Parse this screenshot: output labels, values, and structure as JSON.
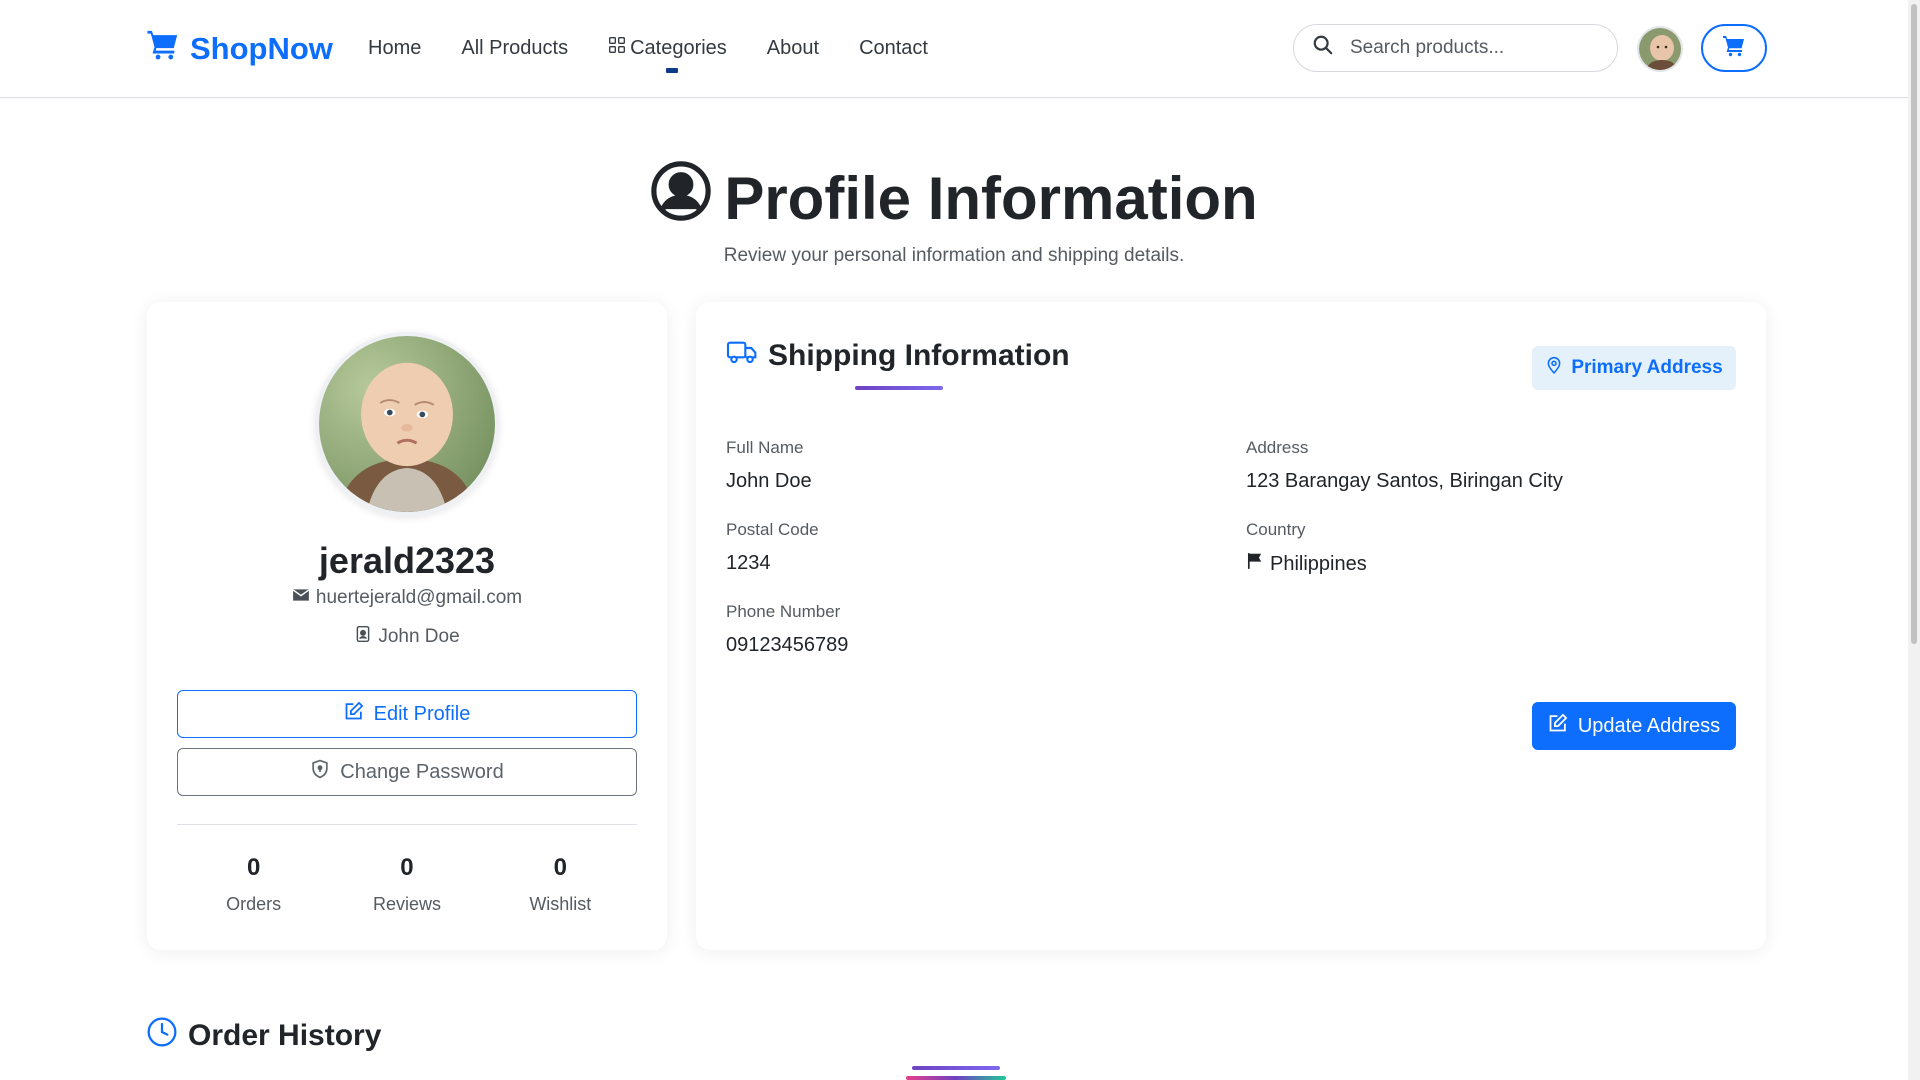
{
  "brand": {
    "name": "ShopNow",
    "color": "#0d6efd"
  },
  "nav": {
    "links": [
      {
        "label": "Home"
      },
      {
        "label": "All Products"
      },
      {
        "label": "Categories",
        "icon": "grid-icon"
      },
      {
        "label": "About"
      },
      {
        "label": "Contact"
      }
    ],
    "search_placeholder": "Search products..."
  },
  "hero": {
    "title": "Profile Information",
    "subtitle": "Review your personal information and shipping details."
  },
  "profile": {
    "username": "jerald2323",
    "email": "huertejerald@gmail.com",
    "full_name": "John Doe",
    "edit_label": "Edit Profile",
    "password_label": "Change Password",
    "stats": [
      {
        "value": "0",
        "label": "Orders"
      },
      {
        "value": "0",
        "label": "Reviews"
      },
      {
        "value": "0",
        "label": "Wishlist"
      }
    ]
  },
  "shipping": {
    "title": "Shipping Information",
    "badge": "Primary Address",
    "fields": {
      "full_name": {
        "label": "Full Name",
        "value": "John Doe"
      },
      "address": {
        "label": "Address",
        "value": "123 Barangay Santos, Biringan City"
      },
      "postal": {
        "label": "Postal Code",
        "value": "1234"
      },
      "country": {
        "label": "Country",
        "value": "Philippines"
      },
      "phone": {
        "label": "Phone Number",
        "value": "09123456789"
      }
    },
    "update_label": "Update Address"
  },
  "orders": {
    "title": "Order History"
  },
  "colors": {
    "primary": "#0d6efd",
    "accent": "#6f42c1",
    "badge_bg": "#e4f1fb"
  }
}
